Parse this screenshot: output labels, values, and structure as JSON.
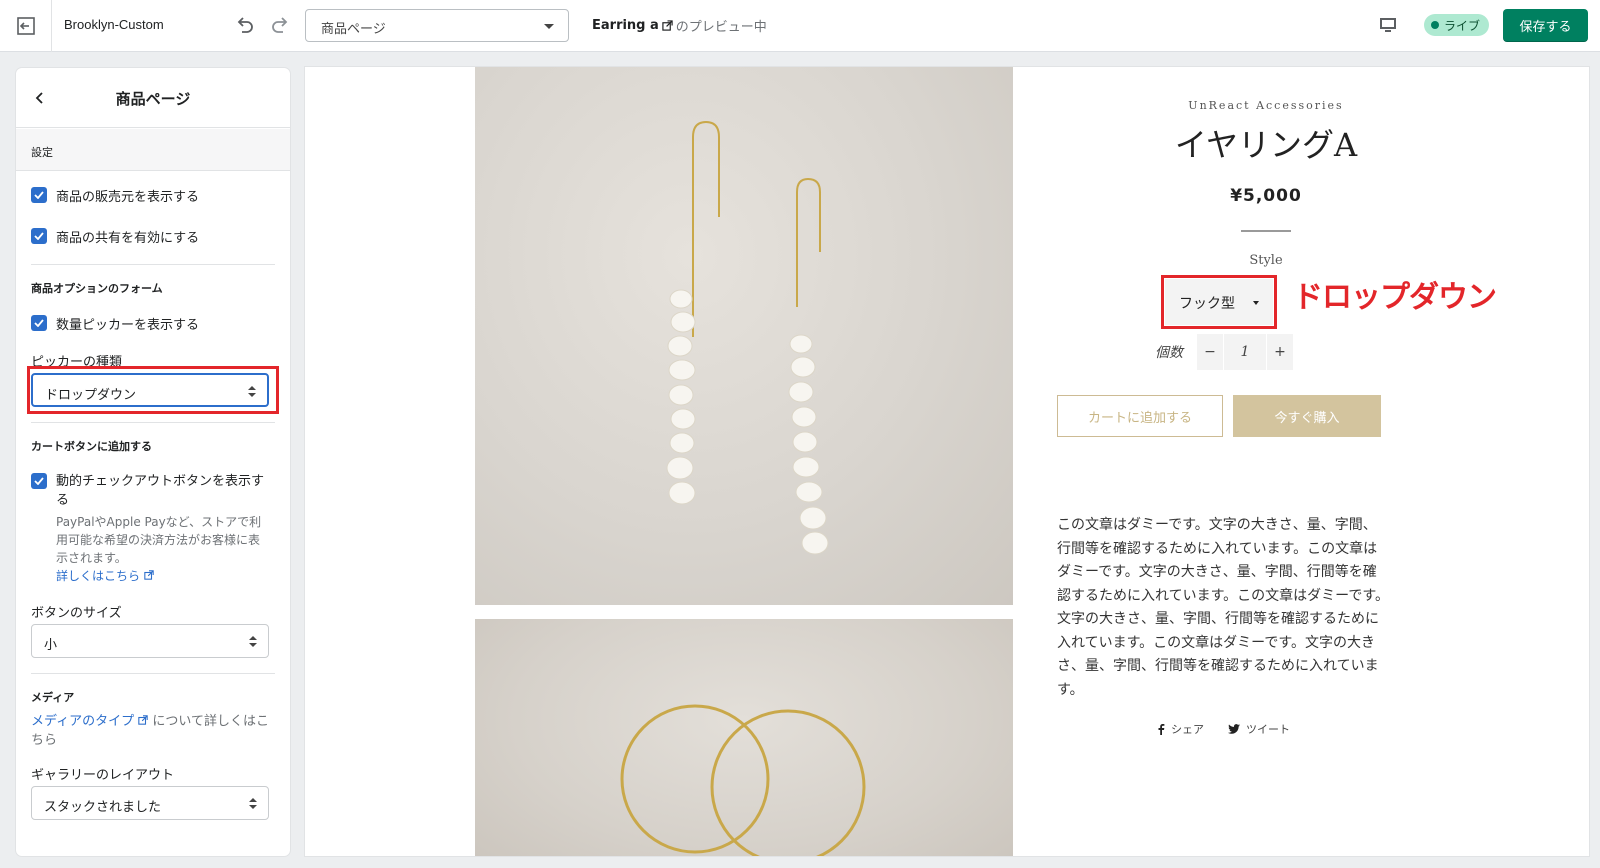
{
  "topbar": {
    "theme_name": "Brooklyn-Custom",
    "page_select_value": "商品ページ",
    "preview_product": "Earring a",
    "preview_suffix": "のプレビュー中",
    "live_label": "ライブ",
    "save_label": "保存する"
  },
  "sidebar": {
    "title": "商品ページ",
    "settings_section": "設定",
    "checkbox_vendor": "商品の販売元を表示する",
    "checkbox_share": "商品の共有を有効にする",
    "option_form_heading": "商品オプションのフォーム",
    "checkbox_qty": "数量ピッカーを表示する",
    "picker_type_label": "ピッカーの種類",
    "picker_type_value": "ドロップダウン",
    "cart_button_heading": "カートボタンに追加する",
    "checkbox_dynamic": "動的チェックアウトボタンを表示する",
    "dynamic_help": "PayPalやApple Payなど、ストアで利用可能な希望の決済方法がお客様に表示されます。",
    "dynamic_link": "詳しくはこちら",
    "button_size_label": "ボタンのサイズ",
    "button_size_value": "小",
    "media_heading": "メディア",
    "media_link": "メディアのタイプ",
    "media_link_suffix": "について詳しくはこちら",
    "gallery_layout_label": "ギャラリーのレイアウト",
    "gallery_layout_value": "スタックされました"
  },
  "preview": {
    "brand": "UnReact Accessories",
    "title": "イヤリングA",
    "price": "¥5,000",
    "style_label": "Style",
    "variant_value": "フック型",
    "annotation": "ドロップダウン",
    "qty_label": "個数",
    "qty_minus": "−",
    "qty_value": "1",
    "qty_plus": "+",
    "add_to_cart": "カートに追加する",
    "buy_now": "今すぐ購入",
    "description": "この文章はダミーです。文字の大きさ、量、字間、行間等を確認するために入れています。この文章はダミーです。文字の大きさ、量、字間、行間等を確認するために入れています。この文章はダミーです。文字の大きさ、量、字間、行間等を確認するために入れています。この文章はダミーです。文字の大きさ、量、字間、行間等を確認するために入れています。",
    "share_label": "シェア",
    "tweet_label": "ツイート"
  },
  "colors": {
    "save_green": "#008060",
    "live_badge": "#aee9d1",
    "checkbox_blue": "#2c6ecb",
    "annotation_red": "#e3262a",
    "buy_button": "#d3c49e"
  },
  "icons": [
    "exit-icon",
    "undo-icon",
    "redo-icon",
    "chevron-down-icon",
    "external-link-icon",
    "desktop-icon",
    "back-chevron-icon",
    "checkmark-icon",
    "select-arrows-icon",
    "facebook-icon",
    "twitter-icon"
  ]
}
